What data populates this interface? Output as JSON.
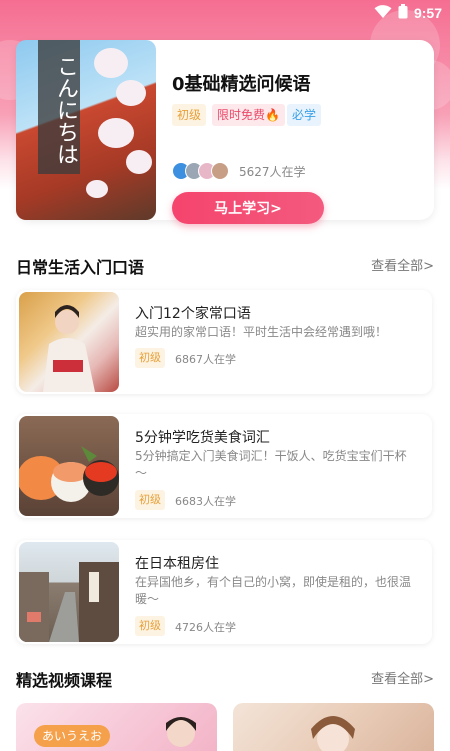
{
  "status": {
    "time": "9:57"
  },
  "featured": {
    "thumb_text": "こんにちは",
    "title": "0基础精选问候语",
    "tags": {
      "level": "初级",
      "free": "限时免费🔥",
      "must": "必学"
    },
    "learners": "5627人在学",
    "button": "马上学习>"
  },
  "section_daily": {
    "title": "日常生活入门口语",
    "see_all": "查看全部>"
  },
  "courses": [
    {
      "title": "入门12个家常口语",
      "desc": "超实用的家常口语！平时生活中会经常遇到哦！",
      "level": "初级",
      "learners": "6867人在学"
    },
    {
      "title": "5分钟学吃货美食词汇",
      "desc": "5分钟搞定入门美食词汇！干饭人、吃货宝宝们干杯～",
      "level": "初级",
      "learners": "6683人在学"
    },
    {
      "title": "在日本租房住",
      "desc": "在异国他乡，有个自己的小窝，即使是租的，也很温暖～",
      "level": "初级",
      "learners": "4726人在学"
    }
  ],
  "section_video": {
    "title": "精选视频课程",
    "see_all": "查看全部>"
  },
  "video_cards": [
    {
      "label": "あいうえお"
    }
  ],
  "colors": {
    "accent": "#f5446d",
    "level_tag": "#e7a13a",
    "must_tag": "#3aa0e8"
  }
}
